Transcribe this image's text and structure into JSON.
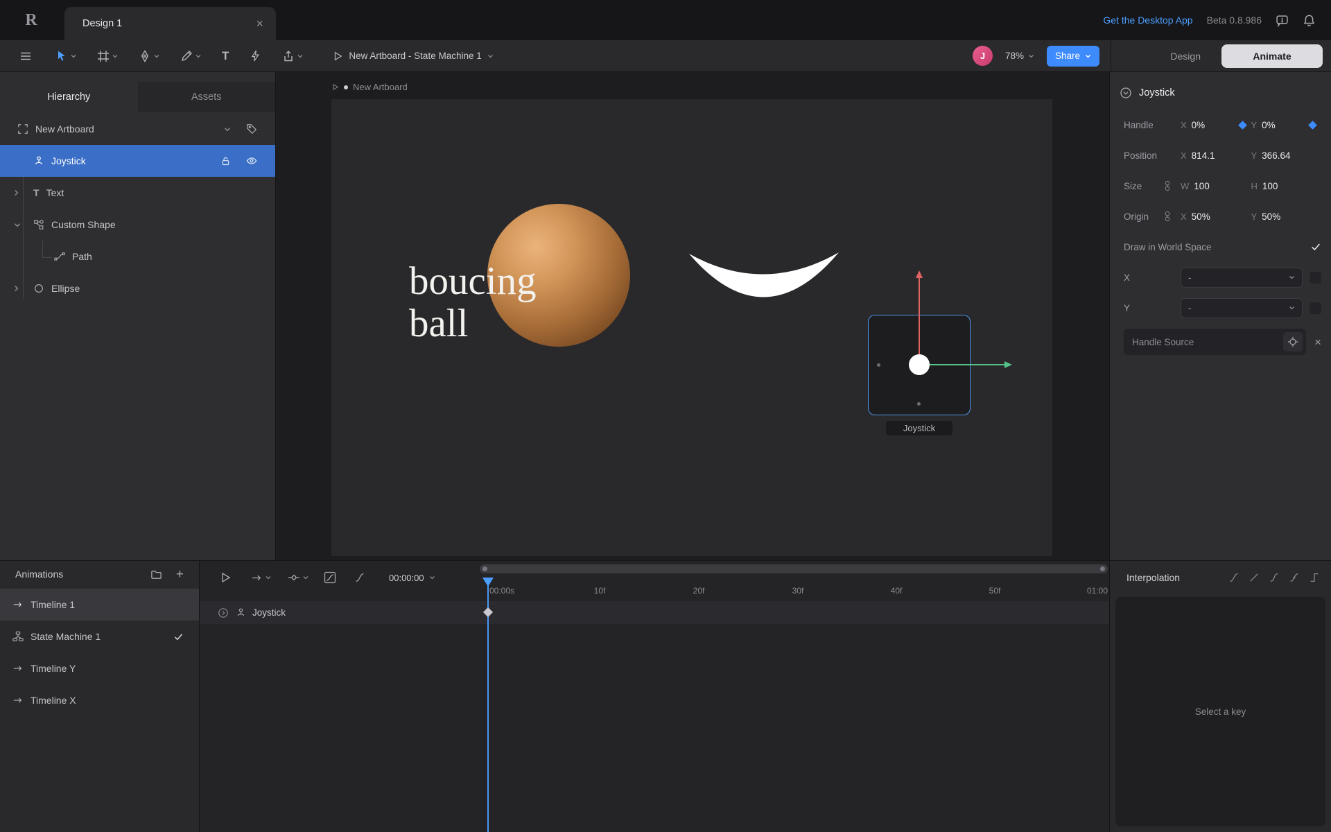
{
  "colors": {
    "accent_blue": "#4C9FFF",
    "selection_blue": "#3B6FC7",
    "share_blue": "#3D8BFD",
    "avatar_pink": "#D8497F",
    "axis_red": "#E06363",
    "axis_green": "#55C287",
    "ball_highlight": "#EAB37B",
    "ball_shadow": "#5E3617",
    "animate_pill": "#DCDCE1"
  },
  "icons": {
    "logo": "R",
    "close": "×",
    "plus": "+",
    "text_tool": "T"
  },
  "topbar": {
    "tab_title": "Design 1",
    "desktop_app_link": "Get the Desktop App",
    "beta_label": "Beta 0.8.986"
  },
  "toolbar": {
    "artboard_selector": "New Artboard - State Machine 1",
    "avatar_initial": "J",
    "zoom_level": "78%",
    "share_label": "Share",
    "design_label": "Design",
    "animate_label": "Animate"
  },
  "hierarchy": {
    "tab_hierarchy": "Hierarchy",
    "tab_assets": "Assets",
    "tree": [
      {
        "label": "New Artboard"
      },
      {
        "label": "Joystick"
      },
      {
        "label": "Text"
      },
      {
        "label": "Custom Shape"
      },
      {
        "label": "Path"
      },
      {
        "label": "Ellipse"
      }
    ]
  },
  "canvas": {
    "artboard_label": "New Artboard",
    "ball_text_line1": "boucing",
    "ball_text_line2": "ball",
    "joystick_tooltip": "Joystick"
  },
  "inspector": {
    "title": "Joystick",
    "handle": {
      "label": "Handle",
      "x_label": "X",
      "x_value": "0%",
      "y_label": "Y",
      "y_value": "0%"
    },
    "position": {
      "label": "Position",
      "x_label": "X",
      "x_value": "814.1",
      "y_label": "Y",
      "y_value": "366.64"
    },
    "size": {
      "label": "Size",
      "w_label": "W",
      "w_value": "100",
      "h_label": "H",
      "h_value": "100"
    },
    "origin": {
      "label": "Origin",
      "x_label": "X",
      "x_value": "50%",
      "y_label": "Y",
      "y_value": "50%"
    },
    "world_space_label": "Draw in World Space",
    "x_binding": {
      "label": "X",
      "value": "-"
    },
    "y_binding": {
      "label": "Y",
      "value": "-"
    },
    "handle_source_label": "Handle Source"
  },
  "animations": {
    "title": "Animations",
    "items": [
      {
        "label": "Timeline 1"
      },
      {
        "label": "State Machine 1"
      },
      {
        "label": "Timeline Y"
      },
      {
        "label": "Timeline X"
      }
    ]
  },
  "timeline": {
    "current_time": "00:00:00",
    "ruler": [
      "00:00s",
      "10f",
      "20f",
      "30f",
      "40f",
      "50f",
      "01:00"
    ],
    "track_label": "Joystick"
  },
  "interpolation": {
    "title": "Interpolation",
    "empty_state": "Select a key"
  }
}
